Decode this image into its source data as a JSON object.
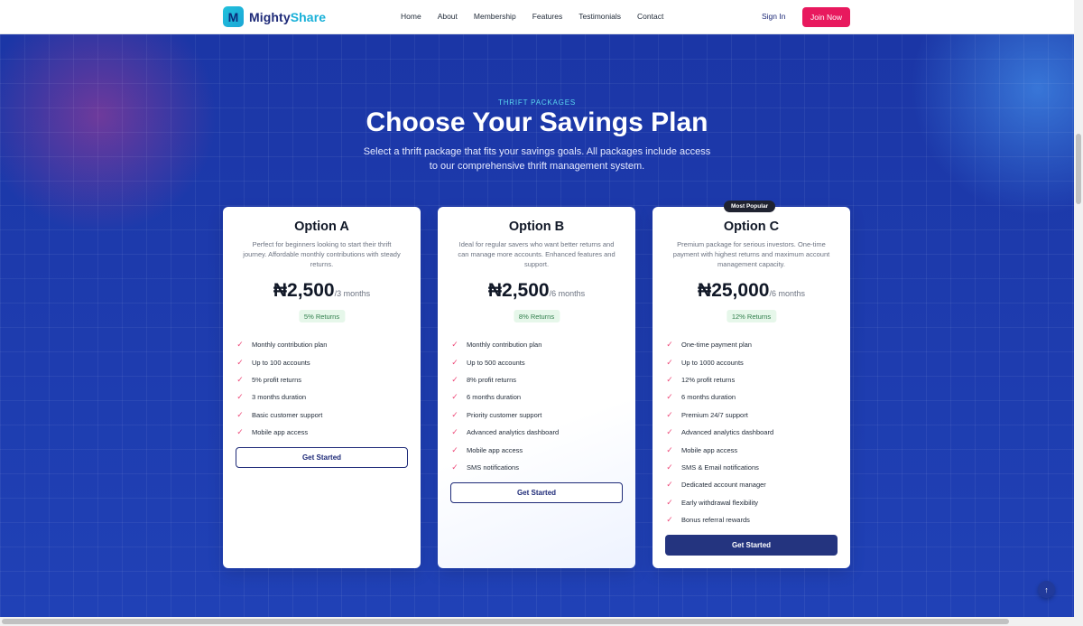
{
  "brand": {
    "logo_letter": "M",
    "name_part1": "Mighty",
    "name_part2": "Share"
  },
  "nav": {
    "items": [
      "Home",
      "About",
      "Membership",
      "Features",
      "Testimonials",
      "Contact"
    ]
  },
  "header": {
    "signin_label": "Sign In",
    "join_label": "Join Now"
  },
  "section": {
    "eyebrow": "THRIFT PACKAGES",
    "title": "Choose Your Savings Plan",
    "subtitle": "Select a thrift package that fits your savings goals. All packages include access to our comprehensive thrift management system."
  },
  "plans": [
    {
      "name": "Option A",
      "description": "Perfect for beginners looking to start their thrift journey. Affordable monthly contributions with steady returns.",
      "price": "₦2,500",
      "period": "/3 months",
      "returns": "5% Returns",
      "features": [
        "Monthly contribution plan",
        "Up to 100 accounts",
        "5% profit returns",
        "3 months duration",
        "Basic customer support",
        "Mobile app access"
      ],
      "button": "Get Started"
    },
    {
      "name": "Option B",
      "description": "Ideal for regular savers who want better returns and can manage more accounts. Enhanced features and support.",
      "price": "₦2,500",
      "period": "/6 months",
      "returns": "8% Returns",
      "features": [
        "Monthly contribution plan",
        "Up to 500 accounts",
        "8% profit returns",
        "6 months duration",
        "Priority customer support",
        "Advanced analytics dashboard",
        "Mobile app access",
        "SMS notifications"
      ],
      "button": "Get Started"
    },
    {
      "name": "Option C",
      "badge": "Most Popular",
      "description": "Premium package for serious investors. One-time payment with highest returns and maximum account management capacity.",
      "price": "₦25,000",
      "period": "/6 months",
      "returns": "12% Returns",
      "features": [
        "One-time payment plan",
        "Up to 1000 accounts",
        "12% profit returns",
        "6 months duration",
        "Premium 24/7 support",
        "Advanced analytics dashboard",
        "Mobile app access",
        "SMS & Email notifications",
        "Dedicated account manager",
        "Early withdrawal flexibility",
        "Bonus referral rewards"
      ],
      "button": "Get Started"
    }
  ],
  "icons": {
    "check": "check-icon",
    "scroll_top": "arrow-up-icon"
  },
  "colors": {
    "brand_navy": "#1e2a78",
    "accent_pink": "#e8195e",
    "accent_cyan": "#18b0d8",
    "returns_green": "#2e7d4a"
  }
}
